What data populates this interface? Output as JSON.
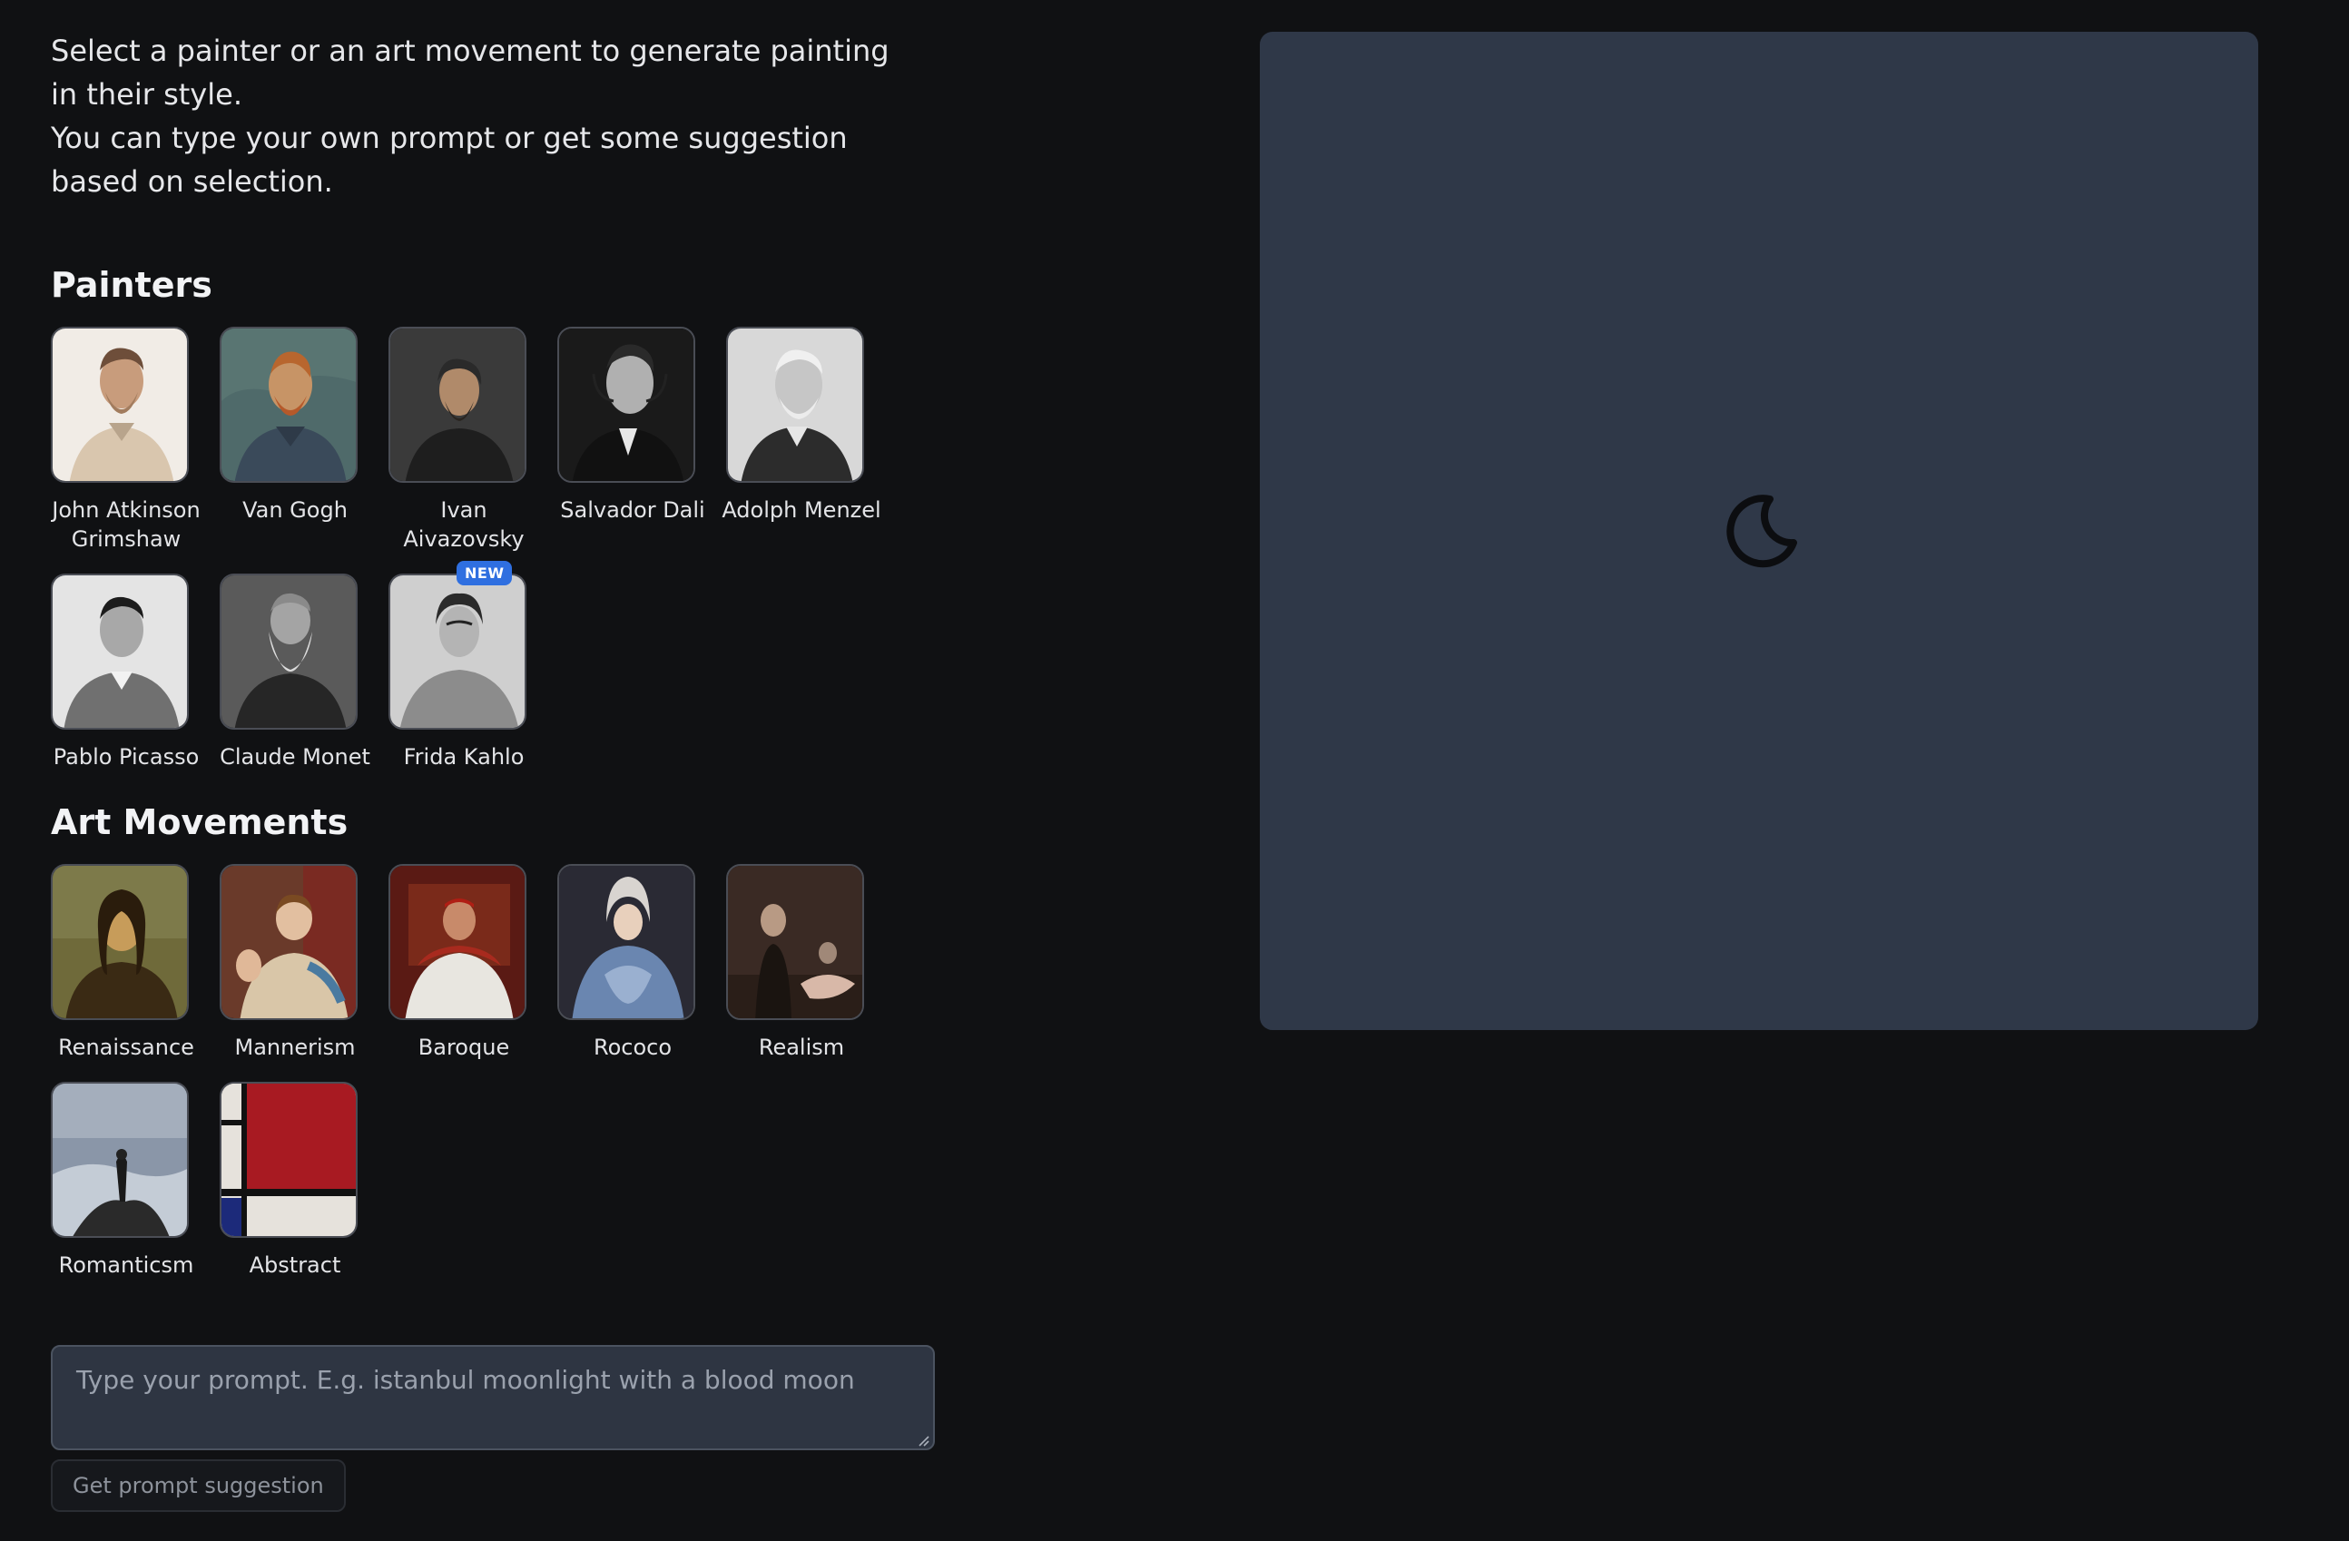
{
  "intro": {
    "line1": "Select a painter or an art movement to generate painting in their style.",
    "line2": "You can type your own prompt or get some suggestion based on selection."
  },
  "painters": {
    "title": "Painters",
    "items": [
      {
        "label": "John Atkinson Grimshaw",
        "icon": "portrait-grimshaw"
      },
      {
        "label": "Van Gogh",
        "icon": "portrait-van-gogh"
      },
      {
        "label": "Ivan Aivazovsky",
        "icon": "portrait-aivazovsky"
      },
      {
        "label": "Salvador Dali",
        "icon": "portrait-dali"
      },
      {
        "label": "Adolph Menzel",
        "icon": "portrait-menzel"
      },
      {
        "label": "Pablo Picasso",
        "icon": "portrait-picasso"
      },
      {
        "label": "Claude Monet",
        "icon": "portrait-monet"
      },
      {
        "label": "Frida Kahlo",
        "icon": "portrait-kahlo",
        "badge": "NEW"
      }
    ]
  },
  "movements": {
    "title": "Art Movements",
    "items": [
      {
        "label": "Renaissance",
        "icon": "painting-renaissance"
      },
      {
        "label": "Mannerism",
        "icon": "painting-mannerism"
      },
      {
        "label": "Baroque",
        "icon": "painting-baroque"
      },
      {
        "label": "Rococo",
        "icon": "painting-rococo"
      },
      {
        "label": "Realism",
        "icon": "painting-realism"
      },
      {
        "label": "Romanticsm",
        "icon": "painting-romanticism"
      },
      {
        "label": "Abstract",
        "icon": "painting-abstract"
      }
    ]
  },
  "prompt": {
    "placeholder": "Type your prompt. E.g. istanbul moonlight with a blood moon",
    "value": ""
  },
  "suggest_button": "Get prompt suggestion",
  "canvas": {
    "icon": "moon-icon",
    "background": "#2f3848"
  },
  "colors": {
    "page_bg": "#101113",
    "badge": "#2f6fe0"
  }
}
